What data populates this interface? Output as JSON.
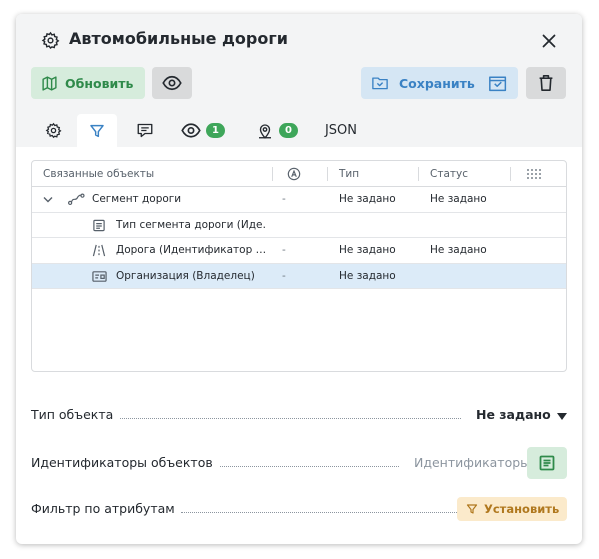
{
  "panel": {
    "title": "Автомобильные дороги",
    "icons": {
      "title": "gear-icon",
      "close": "close-icon"
    }
  },
  "toolbar": {
    "refresh_label": "Обновить",
    "save_label": "Сохранить",
    "icons": {
      "refresh": "map-icon",
      "preview": "eye-icon",
      "save": "save-folder-icon",
      "save_as": "folder-check-icon",
      "delete": "trash-icon"
    }
  },
  "tabs": [
    {
      "id": "settings",
      "icon": "gear-icon",
      "active": false
    },
    {
      "id": "filter",
      "icon": "filter-icon",
      "active": true
    },
    {
      "id": "comments",
      "icon": "message-icon",
      "active": false
    },
    {
      "id": "visible",
      "icon": "eye-icon",
      "badge": "1",
      "active": false
    },
    {
      "id": "location",
      "icon": "map-pin-icon",
      "badge": "0",
      "active": false
    },
    {
      "id": "json",
      "label": "JSON",
      "active": false
    }
  ],
  "table": {
    "columns": [
      "Связанные объекты",
      "",
      "Тип",
      "Статус",
      ""
    ],
    "column_icons": [
      "",
      "a-circle-icon",
      "",
      "",
      "column-settings-icon"
    ],
    "rows": [
      {
        "name": "Сегмент дороги",
        "icon": "road-segment-icon",
        "expand": "chevron-down-icon",
        "a": "-",
        "type": "Не задано",
        "status": "Не задано",
        "selected": false
      },
      {
        "name": "Тип сегмента дороги (Иде…",
        "icon": "document-icon",
        "a": "",
        "type": "",
        "status": "",
        "selected": false
      },
      {
        "name": "Дорога (Идентификатор …",
        "icon": "road-icon",
        "a": "-",
        "type": "Не задано",
        "status": "Не задано",
        "selected": false
      },
      {
        "name": "Организация (Владелец)",
        "icon": "card-icon",
        "a": "-",
        "type": "Не задано",
        "status": "",
        "selected": true
      }
    ]
  },
  "fields": {
    "object_type": {
      "label": "Тип объекта",
      "value": "Не задано",
      "icon": "caret-down-icon"
    },
    "object_ids": {
      "label": "Идентификаторы объектов",
      "placeholder": "Идентификаторы",
      "icon": "list-icon"
    },
    "attr_filter": {
      "label": "Фильтр по атрибутам",
      "button_label": "Установить",
      "icon": "filter-icon"
    }
  },
  "colors": {
    "green": "#3ea65a",
    "blue": "#3a82c4",
    "orange": "#b0781e",
    "selected_row": "#dcebf8"
  }
}
